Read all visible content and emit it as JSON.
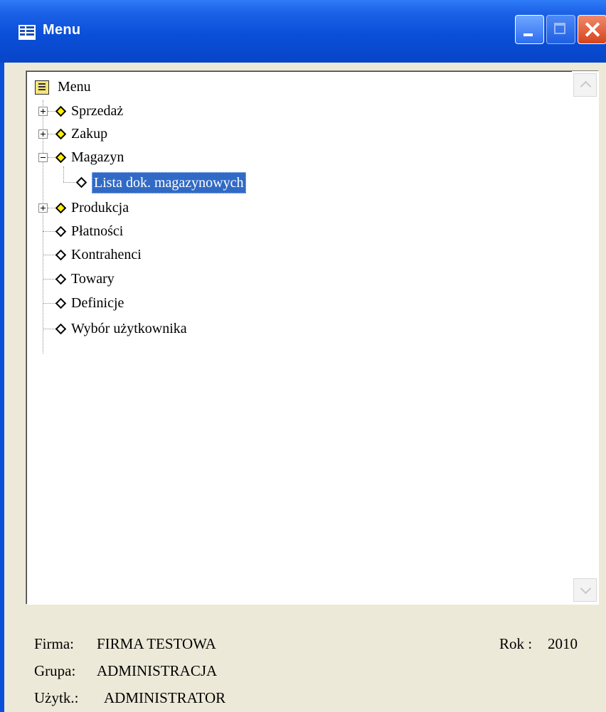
{
  "window": {
    "title": "Menu"
  },
  "tree": {
    "root": "Menu",
    "items": [
      {
        "label": "Sprzedaż",
        "expander": "plus",
        "color": "yellow"
      },
      {
        "label": "Zakup",
        "expander": "plus",
        "color": "yellow"
      },
      {
        "label": "Magazyn",
        "expander": "minus",
        "color": "yellow"
      },
      {
        "label": "Lista dok. magazynowych",
        "child": true,
        "selected": true,
        "color": "white"
      },
      {
        "label": "Produkcja",
        "expander": "plus",
        "color": "yellow"
      },
      {
        "label": "Płatności",
        "color": "white"
      },
      {
        "label": "Kontrahenci",
        "color": "white"
      },
      {
        "label": "Towary",
        "color": "white"
      },
      {
        "label": "Definicje",
        "color": "white"
      },
      {
        "label": "Wybór użytkownika",
        "color": "white"
      }
    ]
  },
  "status": {
    "firma_label": "Firma:",
    "firma_value": "FIRMA TESTOWA",
    "rok_label": "Rok :",
    "rok_value": "2010",
    "grupa_label": "Grupa:",
    "grupa_value": "ADMINISTRACJA",
    "uzytk_label": "Użytk.:",
    "uzytk_value": "ADMINISTRATOR"
  },
  "colors": {
    "titlebar": "#0a4fd8",
    "selection": "#316ac5",
    "panel_bg": "#ece9d8"
  }
}
